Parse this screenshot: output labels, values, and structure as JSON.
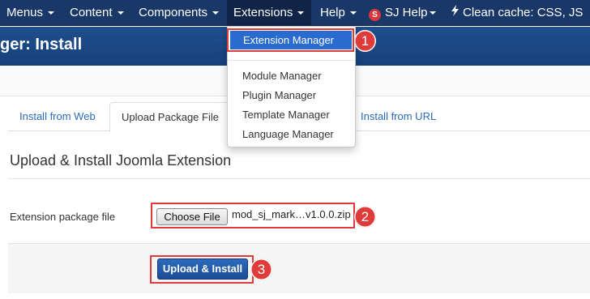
{
  "navbar": {
    "items": [
      {
        "label": "Menus"
      },
      {
        "label": "Content"
      },
      {
        "label": "Components"
      },
      {
        "label": "Extensions"
      },
      {
        "label": "Help"
      },
      {
        "label": "SJ Help",
        "logo": "S"
      },
      {
        "label": "Clean cache: CSS, JS"
      }
    ]
  },
  "page_title": "ger: Install",
  "tabs": [
    {
      "label": "Install from Web"
    },
    {
      "label": "Upload Package File"
    },
    {
      "label": "Install from URL"
    }
  ],
  "section_title": "Upload & Install Joomla Extension",
  "upload_form": {
    "field_label": "Extension package file",
    "choose_button": "Choose File",
    "file_name": "mod_sj_mark…v1.0.0.zip"
  },
  "upload_button": "Upload & Install",
  "dropdown": {
    "highlighted": "Extension Manager",
    "items": [
      "Module Manager",
      "Plugin Manager",
      "Template Manager",
      "Language Manager"
    ]
  },
  "annotations": [
    "1",
    "2",
    "3"
  ],
  "colors": {
    "navbar": "#1a3867",
    "title_bar": "#1d4a86",
    "link": "#2a6bb8",
    "primary_button": "#1f5aa6",
    "highlight": "#2a6bd0",
    "annotation": "#e03b3b"
  }
}
